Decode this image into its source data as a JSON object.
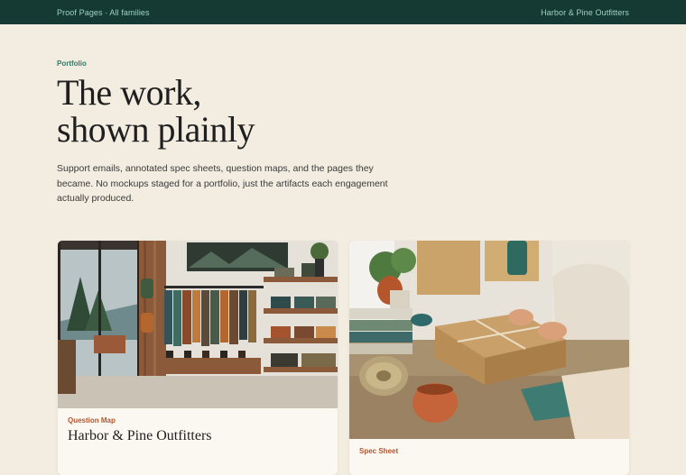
{
  "nav": {
    "breadcrumb": "Proof Pages · All families",
    "brand": "Harbor & Pine Outfitters"
  },
  "hero": {
    "eyebrow": "Portfolio",
    "headline_line1": "The work,",
    "headline_line2": "shown plainly",
    "lede": "Support emails, annotated spec sheets, question maps, and the pages they became. No mockups staged for a portfolio, just the artifacts each engagement actually produced."
  },
  "cards": [
    {
      "tag": "Question Map",
      "title": "Harbor & Pine Outfitters",
      "image": "outfitters-store-interior-photo"
    },
    {
      "tag": "Spec Sheet",
      "title": "",
      "image": "packing-parcel-photo"
    }
  ],
  "colors": {
    "topbar": "#153a33",
    "accent_green": "#2d7a67",
    "tag_rust": "#b5552c",
    "page_bg": "#f3ede1"
  }
}
